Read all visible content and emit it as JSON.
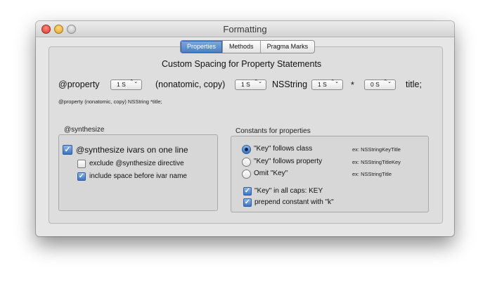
{
  "window": {
    "title": "Formatting"
  },
  "tabs": [
    {
      "label": "Properties",
      "selected": true
    },
    {
      "label": "Methods",
      "selected": false
    },
    {
      "label": "Pragma Marks",
      "selected": false
    }
  ],
  "spacing": {
    "heading": "Custom Spacing for Property Statements",
    "property_keyword": "@property",
    "attributes": "(nonatomic, copy)",
    "type_name": "NSString",
    "asterisk": "*",
    "var_name": "title;",
    "stepper1": "1 S",
    "stepper2": "1 S",
    "stepper3": "1 S",
    "stepper4": "0 S",
    "stepper_arrows": "⌃⌄",
    "preview": "@property (nonatomic, copy) NSString *title;"
  },
  "synthesize": {
    "group_label": "@synthesize",
    "ivars_label": "@synthesize ivars on one line",
    "ivars_checked": true,
    "exclude_label": "exclude @synthesize directive",
    "exclude_checked": false,
    "space_label": "include space before ivar name",
    "space_checked": true
  },
  "constants": {
    "group_label": "Constants for properties",
    "options": [
      {
        "label": "\"Key\" follows class",
        "example": "ex: NSStringKeyTitle",
        "selected": true
      },
      {
        "label": "\"Key\" follows property",
        "example": "ex: NSStringTitleKey",
        "selected": false
      },
      {
        "label": "Omit \"Key\"",
        "example": "ex: NSStringTitle",
        "selected": false
      }
    ],
    "caps_label": "\"Key\" in all caps: KEY",
    "caps_checked": true,
    "prepend_label": "prepend constant with \"k\"",
    "prepend_checked": true
  },
  "colors": {
    "accent": "#3d73bf",
    "panel": "#dedede"
  }
}
